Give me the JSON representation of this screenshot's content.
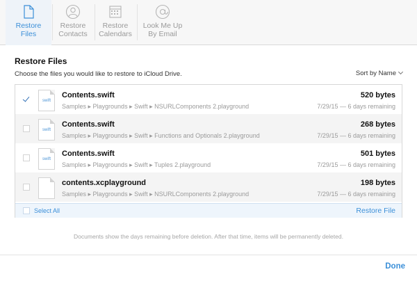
{
  "toolbar": {
    "items": [
      {
        "line1": "Restore",
        "line2": "Files",
        "icon": "document-icon",
        "active": true
      },
      {
        "line1": "Restore",
        "line2": "Contacts",
        "icon": "contact-icon",
        "active": false
      },
      {
        "line1": "Restore",
        "line2": "Calendars",
        "icon": "calendar-icon",
        "active": false
      },
      {
        "line1": "Look Me Up",
        "line2": "By Email",
        "icon": "at-icon",
        "active": false
      }
    ]
  },
  "section": {
    "title": "Restore Files",
    "subtitle": "Choose the files you would like to restore to iCloud Drive.",
    "sort_label": "Sort by Name"
  },
  "files": [
    {
      "name": "Contents.swift",
      "ext": "swift",
      "path": "Samples ▸ Playgrounds ▸ Swift ▸ NSURLComponents 2.playground",
      "size": "520 bytes",
      "meta": "7/29/15 — 6 days remaining",
      "checked": true
    },
    {
      "name": "Contents.swift",
      "ext": "swift",
      "path": "Samples ▸ Playgrounds ▸ Swift ▸ Functions and Optionals 2.playground",
      "size": "268 bytes",
      "meta": "7/29/15 — 6 days remaining",
      "checked": false
    },
    {
      "name": "Contents.swift",
      "ext": "swift",
      "path": "Samples ▸ Playgrounds ▸ Swift ▸ Tuples 2.playground",
      "size": "501 bytes",
      "meta": "7/29/15 — 6 days remaining",
      "checked": false
    },
    {
      "name": "contents.xcplayground",
      "ext": "",
      "path": "Samples ▸ Playgrounds ▸ Swift ▸ NSURLComponents 2.playground",
      "size": "198 bytes",
      "meta": "7/29/15 — 6 days remaining",
      "checked": false
    }
  ],
  "footer": {
    "select_all": "Select All",
    "restore": "Restore File"
  },
  "note": "Documents show the days remaining before deletion. After that time, items will be permanently deleted.",
  "done_label": "Done",
  "colors": {
    "accent": "#3b8fd8",
    "row_alt": "#f4f4f4"
  }
}
